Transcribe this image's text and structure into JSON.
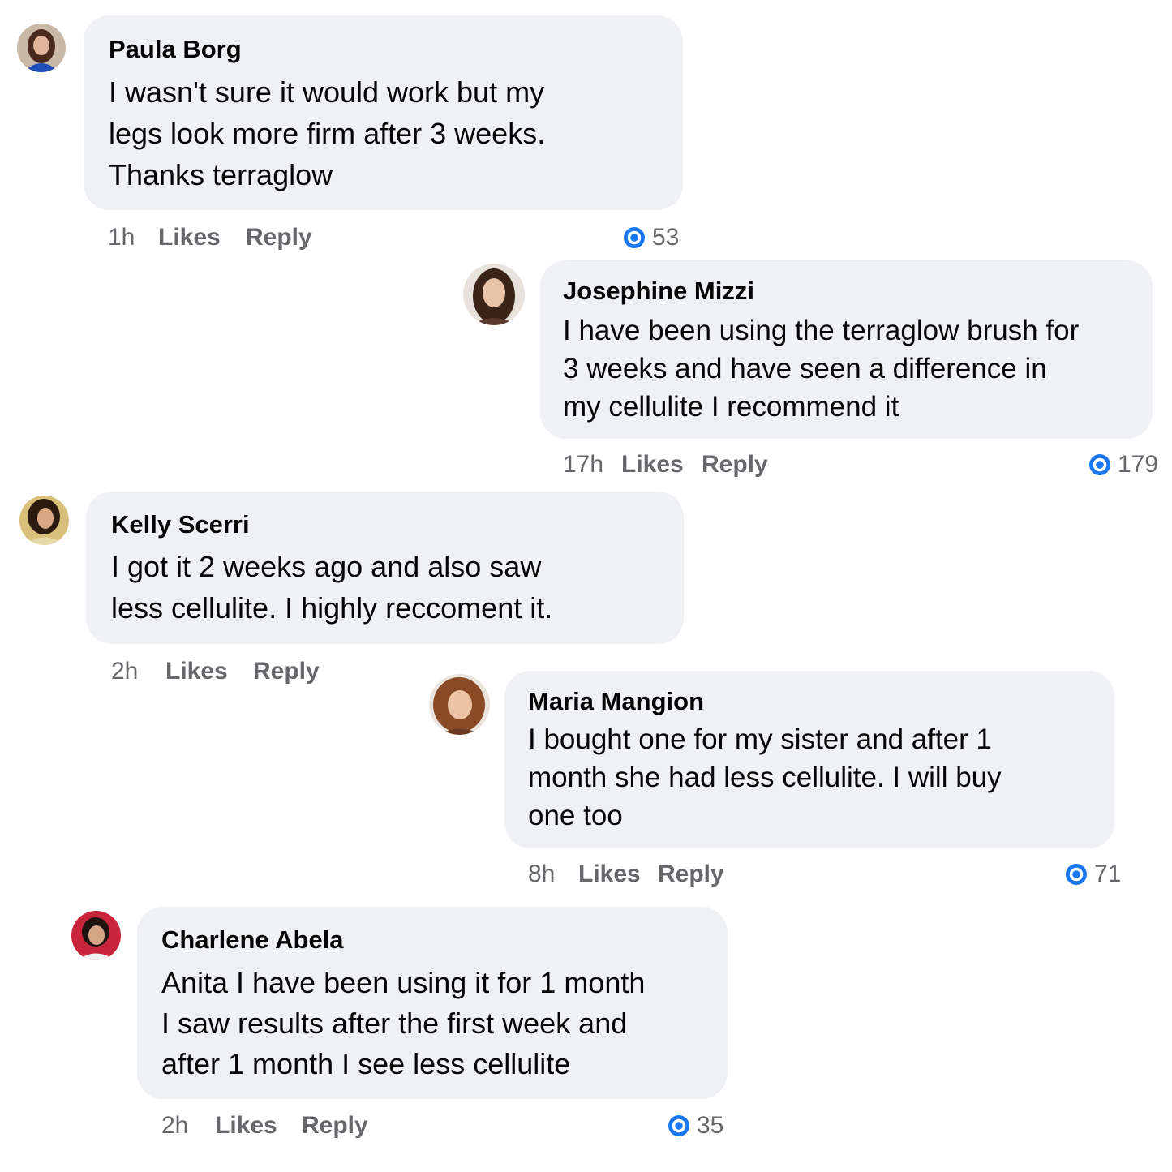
{
  "accent_color": "#1877f2",
  "bubble_color": "#f0f1f4",
  "meta_color": "#65676b",
  "comments": [
    {
      "author": "Paula Borg",
      "text": "I wasn't sure it would work but my\nlegs look more firm after 3 weeks.\nThanks terraglow",
      "time": "1h",
      "like_label": "Likes",
      "reply_label": "Reply",
      "reactions": "53",
      "reaction_icon": "like-icon"
    },
    {
      "author": "Josephine Mizzi",
      "text": "I have been using the terraglow brush for\n3 weeks and have seen a difference in\nmy cellulite I recommend it",
      "time": "17h",
      "like_label": "Likes",
      "reply_label": "Reply",
      "reactions": "179",
      "reaction_icon": "like-icon"
    },
    {
      "author": "Kelly Scerri",
      "text": "I got it 2 weeks ago and also saw\nless cellulite. I highly reccoment it.",
      "time": "2h",
      "like_label": "Likes",
      "reply_label": "Reply"
    },
    {
      "author": "Maria Mangion",
      "text": "I bought one for my sister and after 1\nmonth she had less cellulite. I will buy\none too",
      "time": "8h",
      "like_label": "Likes",
      "reply_label": "Reply",
      "reactions": "71",
      "reaction_icon": "like-icon"
    },
    {
      "author": "Charlene Abela",
      "text": "Anita I have been using it for 1 month\nI saw results after the first week and\nafter 1 month I see less cellulite",
      "time": "2h",
      "like_label": "Likes",
      "reply_label": "Reply",
      "reactions": "35",
      "reaction_icon": "like-icon"
    }
  ]
}
